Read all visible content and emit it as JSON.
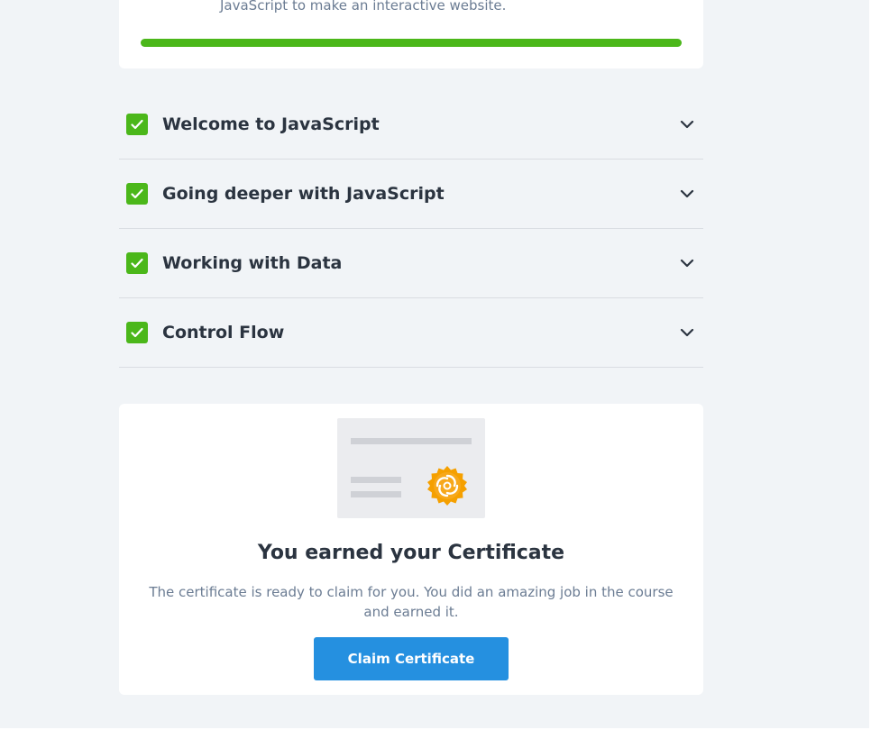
{
  "course_card": {
    "description": "JavaScript to make an interactive website.",
    "progress_percent": 100,
    "progress_color": "#4bb71a"
  },
  "sections": [
    {
      "title": "Welcome to JavaScript",
      "completed": true
    },
    {
      "title": "Going deeper with JavaScript",
      "completed": true
    },
    {
      "title": "Working with Data",
      "completed": true
    },
    {
      "title": "Control Flow",
      "completed": true
    }
  ],
  "certificate": {
    "heading": "You earned your Certificate",
    "text": "The certificate is ready to claim for you. You did an amazing job in the course and earned it.",
    "button_label": "Claim Certificate",
    "badge_icon": "seal-icon",
    "badge_color": "#f5a000"
  },
  "icons": {
    "check": "check-icon",
    "chevron": "chevron-down-icon"
  },
  "colors": {
    "accent": "#2590e0",
    "success": "#4bb71a",
    "background": "#f1f4f7"
  }
}
